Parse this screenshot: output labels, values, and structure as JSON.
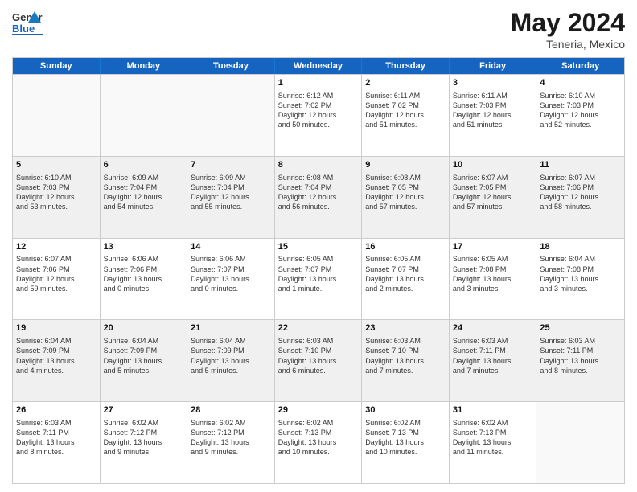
{
  "header": {
    "logo_general": "General",
    "logo_blue": "Blue",
    "month_title": "May 2024",
    "subtitle": "Teneria, Mexico"
  },
  "days_of_week": [
    "Sunday",
    "Monday",
    "Tuesday",
    "Wednesday",
    "Thursday",
    "Friday",
    "Saturday"
  ],
  "weeks": [
    [
      {
        "day": "",
        "info": ""
      },
      {
        "day": "",
        "info": ""
      },
      {
        "day": "",
        "info": ""
      },
      {
        "day": "1",
        "info": "Sunrise: 6:12 AM\nSunset: 7:02 PM\nDaylight: 12 hours\nand 50 minutes."
      },
      {
        "day": "2",
        "info": "Sunrise: 6:11 AM\nSunset: 7:02 PM\nDaylight: 12 hours\nand 51 minutes."
      },
      {
        "day": "3",
        "info": "Sunrise: 6:11 AM\nSunset: 7:03 PM\nDaylight: 12 hours\nand 51 minutes."
      },
      {
        "day": "4",
        "info": "Sunrise: 6:10 AM\nSunset: 7:03 PM\nDaylight: 12 hours\nand 52 minutes."
      }
    ],
    [
      {
        "day": "5",
        "info": "Sunrise: 6:10 AM\nSunset: 7:03 PM\nDaylight: 12 hours\nand 53 minutes."
      },
      {
        "day": "6",
        "info": "Sunrise: 6:09 AM\nSunset: 7:04 PM\nDaylight: 12 hours\nand 54 minutes."
      },
      {
        "day": "7",
        "info": "Sunrise: 6:09 AM\nSunset: 7:04 PM\nDaylight: 12 hours\nand 55 minutes."
      },
      {
        "day": "8",
        "info": "Sunrise: 6:08 AM\nSunset: 7:04 PM\nDaylight: 12 hours\nand 56 minutes."
      },
      {
        "day": "9",
        "info": "Sunrise: 6:08 AM\nSunset: 7:05 PM\nDaylight: 12 hours\nand 57 minutes."
      },
      {
        "day": "10",
        "info": "Sunrise: 6:07 AM\nSunset: 7:05 PM\nDaylight: 12 hours\nand 57 minutes."
      },
      {
        "day": "11",
        "info": "Sunrise: 6:07 AM\nSunset: 7:06 PM\nDaylight: 12 hours\nand 58 minutes."
      }
    ],
    [
      {
        "day": "12",
        "info": "Sunrise: 6:07 AM\nSunset: 7:06 PM\nDaylight: 12 hours\nand 59 minutes."
      },
      {
        "day": "13",
        "info": "Sunrise: 6:06 AM\nSunset: 7:06 PM\nDaylight: 13 hours\nand 0 minutes."
      },
      {
        "day": "14",
        "info": "Sunrise: 6:06 AM\nSunset: 7:07 PM\nDaylight: 13 hours\nand 0 minutes."
      },
      {
        "day": "15",
        "info": "Sunrise: 6:05 AM\nSunset: 7:07 PM\nDaylight: 13 hours\nand 1 minute."
      },
      {
        "day": "16",
        "info": "Sunrise: 6:05 AM\nSunset: 7:07 PM\nDaylight: 13 hours\nand 2 minutes."
      },
      {
        "day": "17",
        "info": "Sunrise: 6:05 AM\nSunset: 7:08 PM\nDaylight: 13 hours\nand 3 minutes."
      },
      {
        "day": "18",
        "info": "Sunrise: 6:04 AM\nSunset: 7:08 PM\nDaylight: 13 hours\nand 3 minutes."
      }
    ],
    [
      {
        "day": "19",
        "info": "Sunrise: 6:04 AM\nSunset: 7:09 PM\nDaylight: 13 hours\nand 4 minutes."
      },
      {
        "day": "20",
        "info": "Sunrise: 6:04 AM\nSunset: 7:09 PM\nDaylight: 13 hours\nand 5 minutes."
      },
      {
        "day": "21",
        "info": "Sunrise: 6:04 AM\nSunset: 7:09 PM\nDaylight: 13 hours\nand 5 minutes."
      },
      {
        "day": "22",
        "info": "Sunrise: 6:03 AM\nSunset: 7:10 PM\nDaylight: 13 hours\nand 6 minutes."
      },
      {
        "day": "23",
        "info": "Sunrise: 6:03 AM\nSunset: 7:10 PM\nDaylight: 13 hours\nand 7 minutes."
      },
      {
        "day": "24",
        "info": "Sunrise: 6:03 AM\nSunset: 7:11 PM\nDaylight: 13 hours\nand 7 minutes."
      },
      {
        "day": "25",
        "info": "Sunrise: 6:03 AM\nSunset: 7:11 PM\nDaylight: 13 hours\nand 8 minutes."
      }
    ],
    [
      {
        "day": "26",
        "info": "Sunrise: 6:03 AM\nSunset: 7:11 PM\nDaylight: 13 hours\nand 8 minutes."
      },
      {
        "day": "27",
        "info": "Sunrise: 6:02 AM\nSunset: 7:12 PM\nDaylight: 13 hours\nand 9 minutes."
      },
      {
        "day": "28",
        "info": "Sunrise: 6:02 AM\nSunset: 7:12 PM\nDaylight: 13 hours\nand 9 minutes."
      },
      {
        "day": "29",
        "info": "Sunrise: 6:02 AM\nSunset: 7:13 PM\nDaylight: 13 hours\nand 10 minutes."
      },
      {
        "day": "30",
        "info": "Sunrise: 6:02 AM\nSunset: 7:13 PM\nDaylight: 13 hours\nand 10 minutes."
      },
      {
        "day": "31",
        "info": "Sunrise: 6:02 AM\nSunset: 7:13 PM\nDaylight: 13 hours\nand 11 minutes."
      },
      {
        "day": "",
        "info": ""
      }
    ]
  ]
}
